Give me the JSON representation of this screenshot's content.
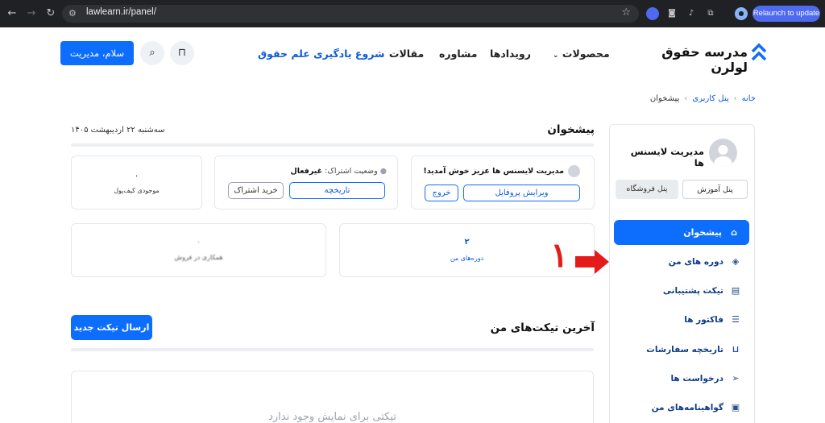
{
  "browser": {
    "url": "lawlearn.ir/panel/",
    "relaunch_label": "Relaunch to update"
  },
  "header": {
    "logo_text": "مدرسه حقوق لولرن",
    "nav": [
      "محصولات",
      "رویدادها",
      "مشاوره",
      "مقالات",
      "شروع یادگیری علم حقوق"
    ],
    "login_label": "سلام، مدیریت"
  },
  "breadcrumb": {
    "home": "خانه",
    "panel": "پنل کاربری",
    "current": "پیشخوان"
  },
  "sidebar": {
    "user_name": "مدیریت لایسنس ها",
    "tab_learning": "پنل آموزش",
    "tab_shop": "پنل فروشگاه",
    "items": [
      {
        "label": "پیشخوان",
        "icon": "home-icon"
      },
      {
        "label": "دوره های من",
        "icon": "graduation-cap-icon"
      },
      {
        "label": "تیکت پشتیبانی",
        "icon": "ticket-icon"
      },
      {
        "label": "فاکتور ها",
        "icon": "invoice-icon"
      },
      {
        "label": "تاریخچه سفارشات",
        "icon": "cart-icon"
      },
      {
        "label": "درخواست ها",
        "icon": "send-icon"
      },
      {
        "label": "گواهینامه‌های من",
        "icon": "certificate-icon"
      }
    ]
  },
  "dashboard": {
    "title": "پیشخوان",
    "date": "سه‌شنبه ۲۲ اردیبهشت ۱۴۰۵",
    "welcome": "مدیریت لایسنس ها عزیز خوش آمدید!",
    "edit_profile": "ویرایش پروفایل",
    "logout": "خروج",
    "subscription_label": "وضعیت اشتراک:",
    "subscription_value": "غیرفعال",
    "history": "تاریخچه",
    "buy_subscription": "خرید اشتراک",
    "wallet_value": "۰",
    "wallet_label": "موجودی کیف‌پول",
    "courses_value": "۲",
    "courses_label": "دوره‌های من",
    "sales_value": "۰",
    "sales_label": "همکاری در فروش"
  },
  "annotation": {
    "number": "۱",
    "color": "#e51b1b"
  },
  "tickets": {
    "title": "آخرین تیکت‌های من",
    "send_new": "ارسال تیکت جدید",
    "empty_text": "تیکتی برای نمایش وجود ندارد"
  },
  "colors": {
    "primary": "#0d6efd",
    "accent_text": "#0d5bd8"
  }
}
